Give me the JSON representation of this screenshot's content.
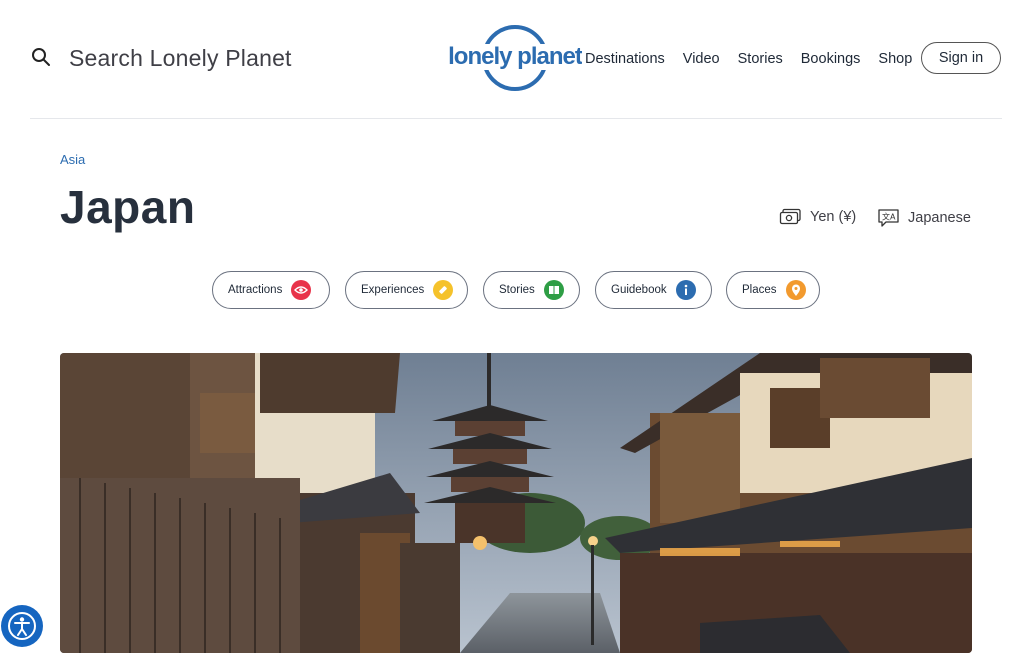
{
  "header": {
    "search_placeholder": "Search Lonely Planet",
    "logo_text": "lonely planet",
    "nav": [
      "Destinations",
      "Video",
      "Stories",
      "Bookings",
      "Shop"
    ],
    "signin_label": "Sign in"
  },
  "page": {
    "breadcrumb": "Asia",
    "title": "Japan",
    "currency": "Yen (¥)",
    "language": "Japanese"
  },
  "pills": [
    {
      "label": "Attractions",
      "icon": "eye-icon",
      "color": "#e8334a"
    },
    {
      "label": "Experiences",
      "icon": "ticket-icon",
      "color": "#f5c22b"
    },
    {
      "label": "Stories",
      "icon": "book-icon",
      "color": "#2e9e45"
    },
    {
      "label": "Guidebook",
      "icon": "info-icon",
      "color": "#2c6cb0"
    },
    {
      "label": "Places",
      "icon": "map-pin-icon",
      "color": "#f29a2e"
    }
  ],
  "colors": {
    "brand": "#2c6cb0",
    "text": "#27303d"
  },
  "hero": {
    "icon": "hero-photo-kyoto-street"
  }
}
